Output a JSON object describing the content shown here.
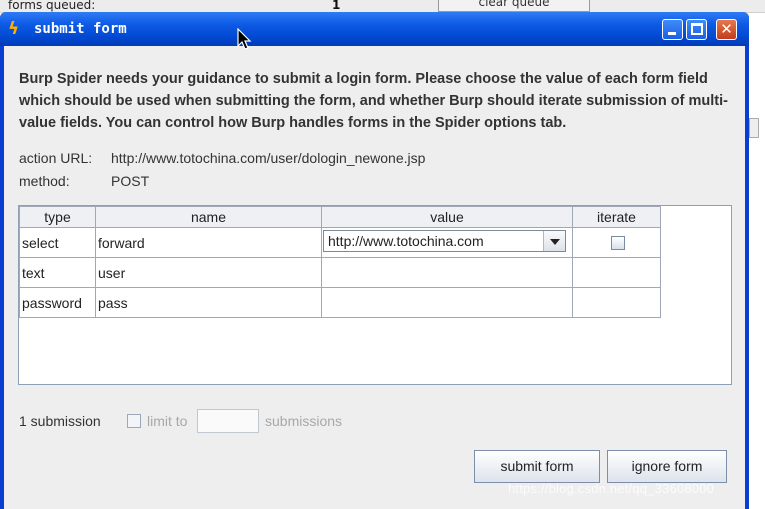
{
  "background": {
    "forms_queued_label": "forms queued:",
    "forms_queued_value": "1",
    "clear_queue_label": "clear queue"
  },
  "window": {
    "title": "submit form"
  },
  "instruction": "Burp Spider needs your guidance to submit a login form. Please choose the value of each form field which should be used when submitting the form, and whether Burp should iterate submission of multi-value fields. You can control how Burp handles forms in the Spider options tab.",
  "info": {
    "action_label": "action URL:",
    "action_value": "http://www.totochina.com/user/dologin_newone.jsp",
    "method_label": "method:",
    "method_value": "POST"
  },
  "table": {
    "headers": [
      "type",
      "name",
      "value",
      "iterate"
    ],
    "rows": [
      {
        "type": "select",
        "name": "forward",
        "value": "http://www.totochina.com",
        "iterate": false
      },
      {
        "type": "text",
        "name": "user",
        "value": "",
        "iterate": null
      },
      {
        "type": "password",
        "name": "pass",
        "value": "",
        "iterate": null
      }
    ]
  },
  "submissions": {
    "count_label": "1 submission",
    "limit_label": "limit to",
    "limit_value": "",
    "unit_label": "submissions"
  },
  "buttons": {
    "submit": "submit form",
    "ignore": "ignore form"
  },
  "watermark": "https://blog.csdn.net/qq_33608000",
  "colors": {
    "titlebar": "#0148d0",
    "close_button": "#c23c1b",
    "client_bg": "#eeeeee"
  },
  "icons": {
    "app": "burp-lightning-icon",
    "minimize": "minimize-icon",
    "maximize": "maximize-icon",
    "close": "close-icon",
    "dropdown": "chevron-down-icon",
    "cursor": "mouse-cursor-icon"
  }
}
